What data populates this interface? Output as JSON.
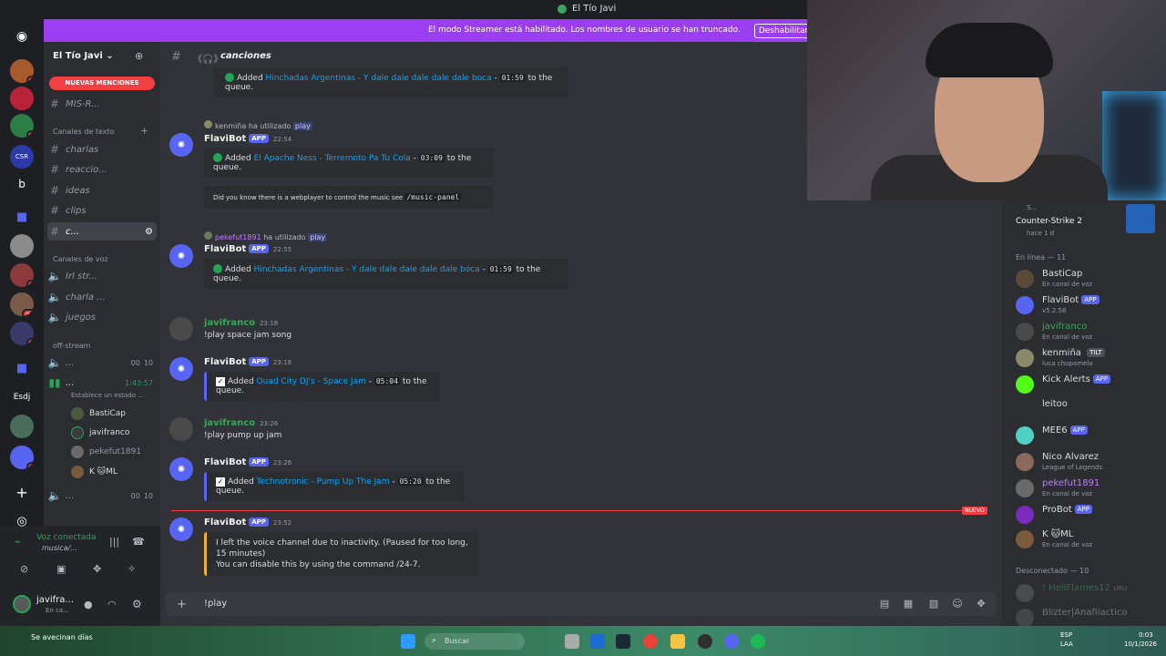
{
  "window": {
    "title": "El Tío Javi"
  },
  "banner": {
    "message": "El modo Streamer está habilitado. Los nombres de usuario se han truncado.",
    "button": "Deshabilitar"
  },
  "server": {
    "name": "El Tío Javi",
    "mentions_pill": "NUEVAS MENCIONES"
  },
  "guild_labels": {
    "b": "b",
    "esdj": "Esdj",
    "csr": "CSR"
  },
  "guild_badges": [
    "2",
    "1",
    "3",
    "27",
    "2",
    "2"
  ],
  "channels": {
    "top": {
      "label": "MIS-R..."
    },
    "text_category": "Canales de texto",
    "text": [
      {
        "label": "charlas"
      },
      {
        "label": "reaccio..."
      },
      {
        "label": "ideas"
      },
      {
        "label": "clips"
      },
      {
        "label": "c..."
      }
    ],
    "voice_category": "Canales de voz",
    "voice": [
      {
        "label": "Irl str..."
      },
      {
        "label": "charla ..."
      },
      {
        "label": "juegos"
      }
    ],
    "offstream_category": "off-stream",
    "offstream": [
      {
        "label": "...",
        "count_a": "00",
        "count_b": "10"
      },
      {
        "label": "...",
        "timer": "1:43:57",
        "status": "Establece un estado ..."
      },
      {
        "label": "...",
        "count_a": "00",
        "count_b": "10"
      }
    ],
    "voice_users": [
      "BastiCap",
      "javifranco",
      "pekefut1891",
      "K 🐱ML"
    ]
  },
  "voice_panel": {
    "status": "Voz conectada",
    "channel": "musica/..."
  },
  "user_panel": {
    "name": "javifra...",
    "status": "En ca..."
  },
  "chat": {
    "channel_name": "canciones",
    "messages": [
      {
        "embed_pre": "Added ",
        "embed_song": "Hinchadas Argentinas - Y dale dale dale dale dale boca",
        "embed_sep": " - ",
        "embed_dur": "01:59",
        "embed_post": " to the queue."
      },
      {
        "slash_user": "kenmiña",
        "slash_mid": " ha utilizado ",
        "slash_cmd": "play",
        "author": "FlaviBot",
        "badge": "APP",
        "time": "22:54",
        "embed_pre": "Added ",
        "embed_song": "El Apache Ness - Terremoto Pa Tu Cola",
        "embed_sep": " - ",
        "embed_dur": "03:09",
        "embed_post": " to the queue.",
        "note": "Did you know there is a webplayer to control the music see ",
        "note_code": "/music-panel"
      },
      {
        "slash_user": "pekefut1891",
        "slash_mid": " ha utilizado ",
        "slash_cmd": "play",
        "author": "FlaviBot",
        "badge": "APP",
        "time": "22:55",
        "embed_pre": "Added ",
        "embed_song": "Hinchadas Argentinas - Y dale dale dale dale dale boca",
        "embed_sep": " - ",
        "embed_dur": "01:59",
        "embed_post": " to the queue."
      },
      {
        "author": "javifranco",
        "time": "23:18",
        "text": "!play space jam song"
      },
      {
        "author": "FlaviBot",
        "badge": "APP",
        "time": "23:18",
        "embed_pre": "Added ",
        "embed_song": "Quad City DJ's - Space Jam",
        "embed_sep": " - ",
        "embed_dur": "05:04",
        "embed_post": " to the queue."
      },
      {
        "author": "javifranco",
        "time": "23:26",
        "text": "!play pump up jam"
      },
      {
        "author": "FlaviBot",
        "badge": "APP",
        "time": "23:26",
        "embed_pre": "Added ",
        "embed_song": "Technotronic - Pump Up The Jam",
        "embed_sep": " - ",
        "embed_dur": "05:20",
        "embed_post": " to the queue."
      },
      {
        "author": "FlaviBot",
        "badge": "APP",
        "time": "23:52",
        "line1": "I left the voice channel due to inactivity. (Paused for too long, 15 minutes)",
        "line2": "You can disable this by using the command /24-7."
      }
    ],
    "new_label": "NUEVO",
    "composer_value": "!play"
  },
  "activity": {
    "game": "Counter-Strike 2",
    "ago": "hace 1 d",
    "prefix": "S..."
  },
  "members": {
    "online_header": "En línea — 11",
    "online": [
      {
        "name": "BastiCap",
        "sub": "En canal de voz",
        "color": "#dbdee1"
      },
      {
        "name": "FlaviBot",
        "badge": "APP",
        "sub": "v5.2.58",
        "color": "#dbdee1"
      },
      {
        "name": "javifranco",
        "sub": "En canal de voz",
        "color": "#3ba55c"
      },
      {
        "name": "kenmiña",
        "tag": "TILT",
        "sub": "luca chupamela",
        "color": "#dbdee1"
      },
      {
        "name": "Kick Alerts",
        "badge": "APP",
        "sub": "",
        "color": "#dbdee1"
      },
      {
        "name": "leitoo",
        "sub": "",
        "color": "#dbdee1"
      },
      {
        "name": "MEE6",
        "badge": "APP",
        "sub": "",
        "color": "#dbdee1"
      },
      {
        "name": "Nico Alvarez",
        "sub": "League of Legends",
        "color": "#dbdee1"
      },
      {
        "name": "pekefut1891",
        "sub": "En canal de voz",
        "color": "#c37bff"
      },
      {
        "name": "ProBot",
        "badge": "APP",
        "sub": "",
        "color": "#dbdee1"
      },
      {
        "name": "K 🐱ML",
        "sub": "En canal de voz",
        "color": "#dbdee1"
      }
    ],
    "offline_header": "Desconectado — 10",
    "offline": [
      {
        "name": "! HellFlames12",
        "tag": "URU"
      },
      {
        "name": "Blizter|Anafilactico"
      }
    ]
  },
  "taskbar": {
    "search": "Buscar",
    "weather": "Se avecinan días",
    "lang": "ESP",
    "lang2": "LAA",
    "time": "0:03",
    "date": "10/1/2026"
  }
}
